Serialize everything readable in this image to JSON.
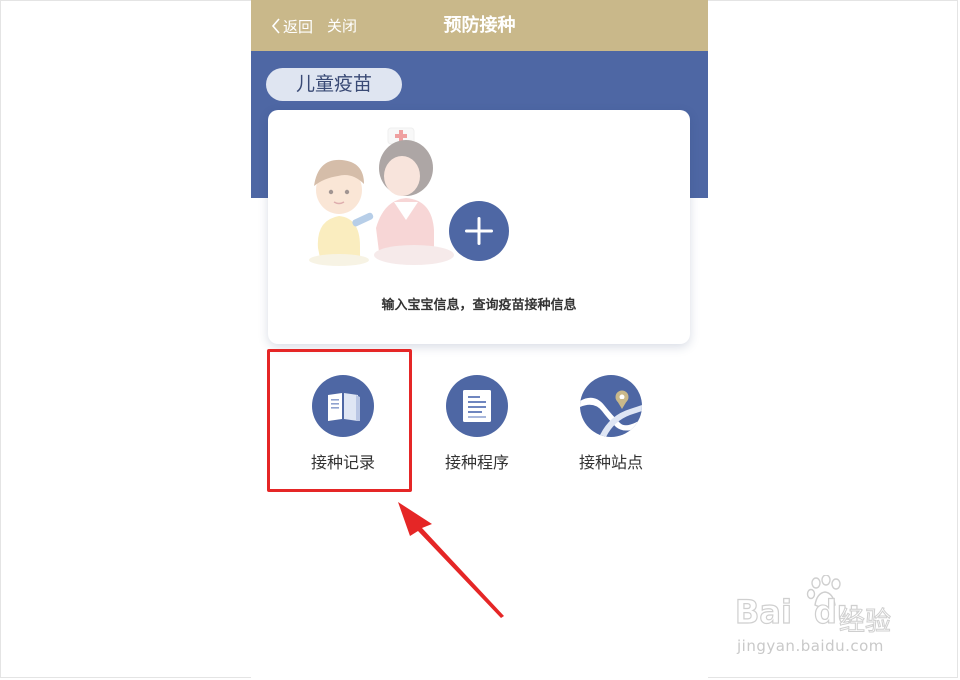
{
  "nav": {
    "back_label": "返回",
    "close_label": "关闭",
    "title": "预防接种"
  },
  "category": {
    "label": "儿童疫苗"
  },
  "card": {
    "prompt": "输入宝宝信息，查询疫苗接种信息"
  },
  "features": [
    {
      "label": "接种记录",
      "icon": "book-icon"
    },
    {
      "label": "接种程序",
      "icon": "document-list-icon"
    },
    {
      "label": "接种站点",
      "icon": "map-location-icon"
    }
  ],
  "annotation": {
    "highlighted_item": "接种记录",
    "color": "#e52626"
  },
  "watermark": {
    "brand": "Bai",
    "brand_suffix": "du",
    "product": "经验",
    "url": "jingyan.baidu.com"
  },
  "colors": {
    "nav_bar": "#c9b88a",
    "hero_bg": "#4e67a4",
    "accent_blue": "#4e67a4",
    "pill_bg": "#dfe5f1"
  }
}
